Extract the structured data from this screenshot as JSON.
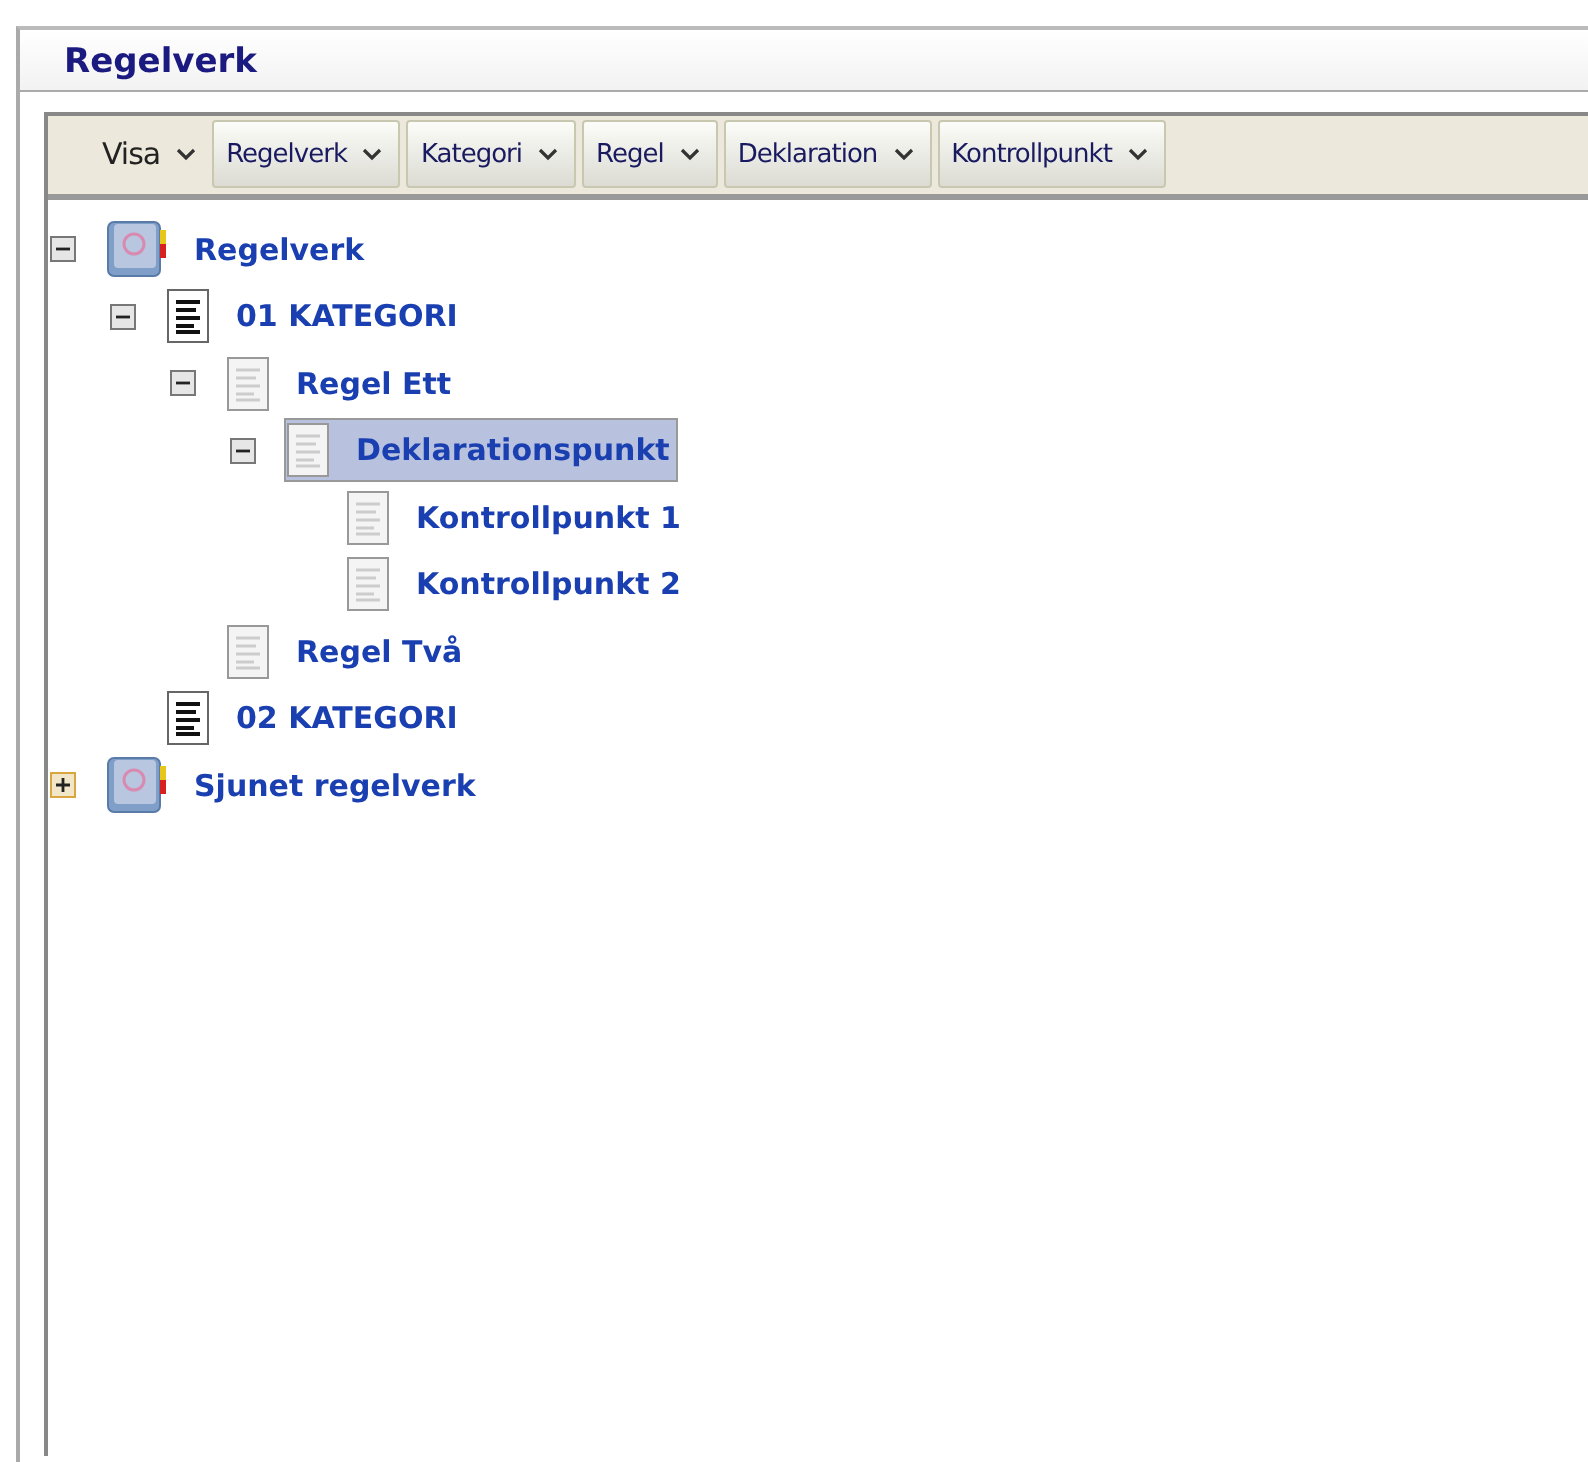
{
  "window": {
    "title": "Regelverk"
  },
  "toolbar": [
    {
      "label": "Visa",
      "kind": "flat"
    },
    {
      "label": "Regelverk",
      "kind": "button"
    },
    {
      "label": "Kategori",
      "kind": "button"
    },
    {
      "label": "Regel",
      "kind": "button"
    },
    {
      "label": "Deklaration",
      "kind": "button"
    },
    {
      "label": "Kontrollpunkt",
      "kind": "button"
    }
  ],
  "tree": [
    {
      "label": "Regelverk",
      "kind": "book",
      "expanded": true,
      "selected": false,
      "children": [
        {
          "label": "01 KATEGORI",
          "kind": "category",
          "expanded": true,
          "selected": false,
          "children": [
            {
              "label": "Regel Ett",
              "kind": "doc",
              "expanded": true,
              "selected": false,
              "children": [
                {
                  "label": "Deklarationspunkt",
                  "kind": "doc",
                  "expanded": true,
                  "selected": true,
                  "children": [
                    {
                      "label": "Kontrollpunkt 1",
                      "kind": "doc",
                      "selected": false
                    },
                    {
                      "label": "Kontrollpunkt 2",
                      "kind": "doc",
                      "selected": false
                    }
                  ]
                }
              ]
            },
            {
              "label": "Regel Två",
              "kind": "doc",
              "selected": false
            }
          ]
        },
        {
          "label": "02 KATEGORI",
          "kind": "category",
          "selected": false
        }
      ]
    },
    {
      "label": "Sjunet regelverk",
      "kind": "book",
      "expanded": false,
      "selected": false
    }
  ]
}
